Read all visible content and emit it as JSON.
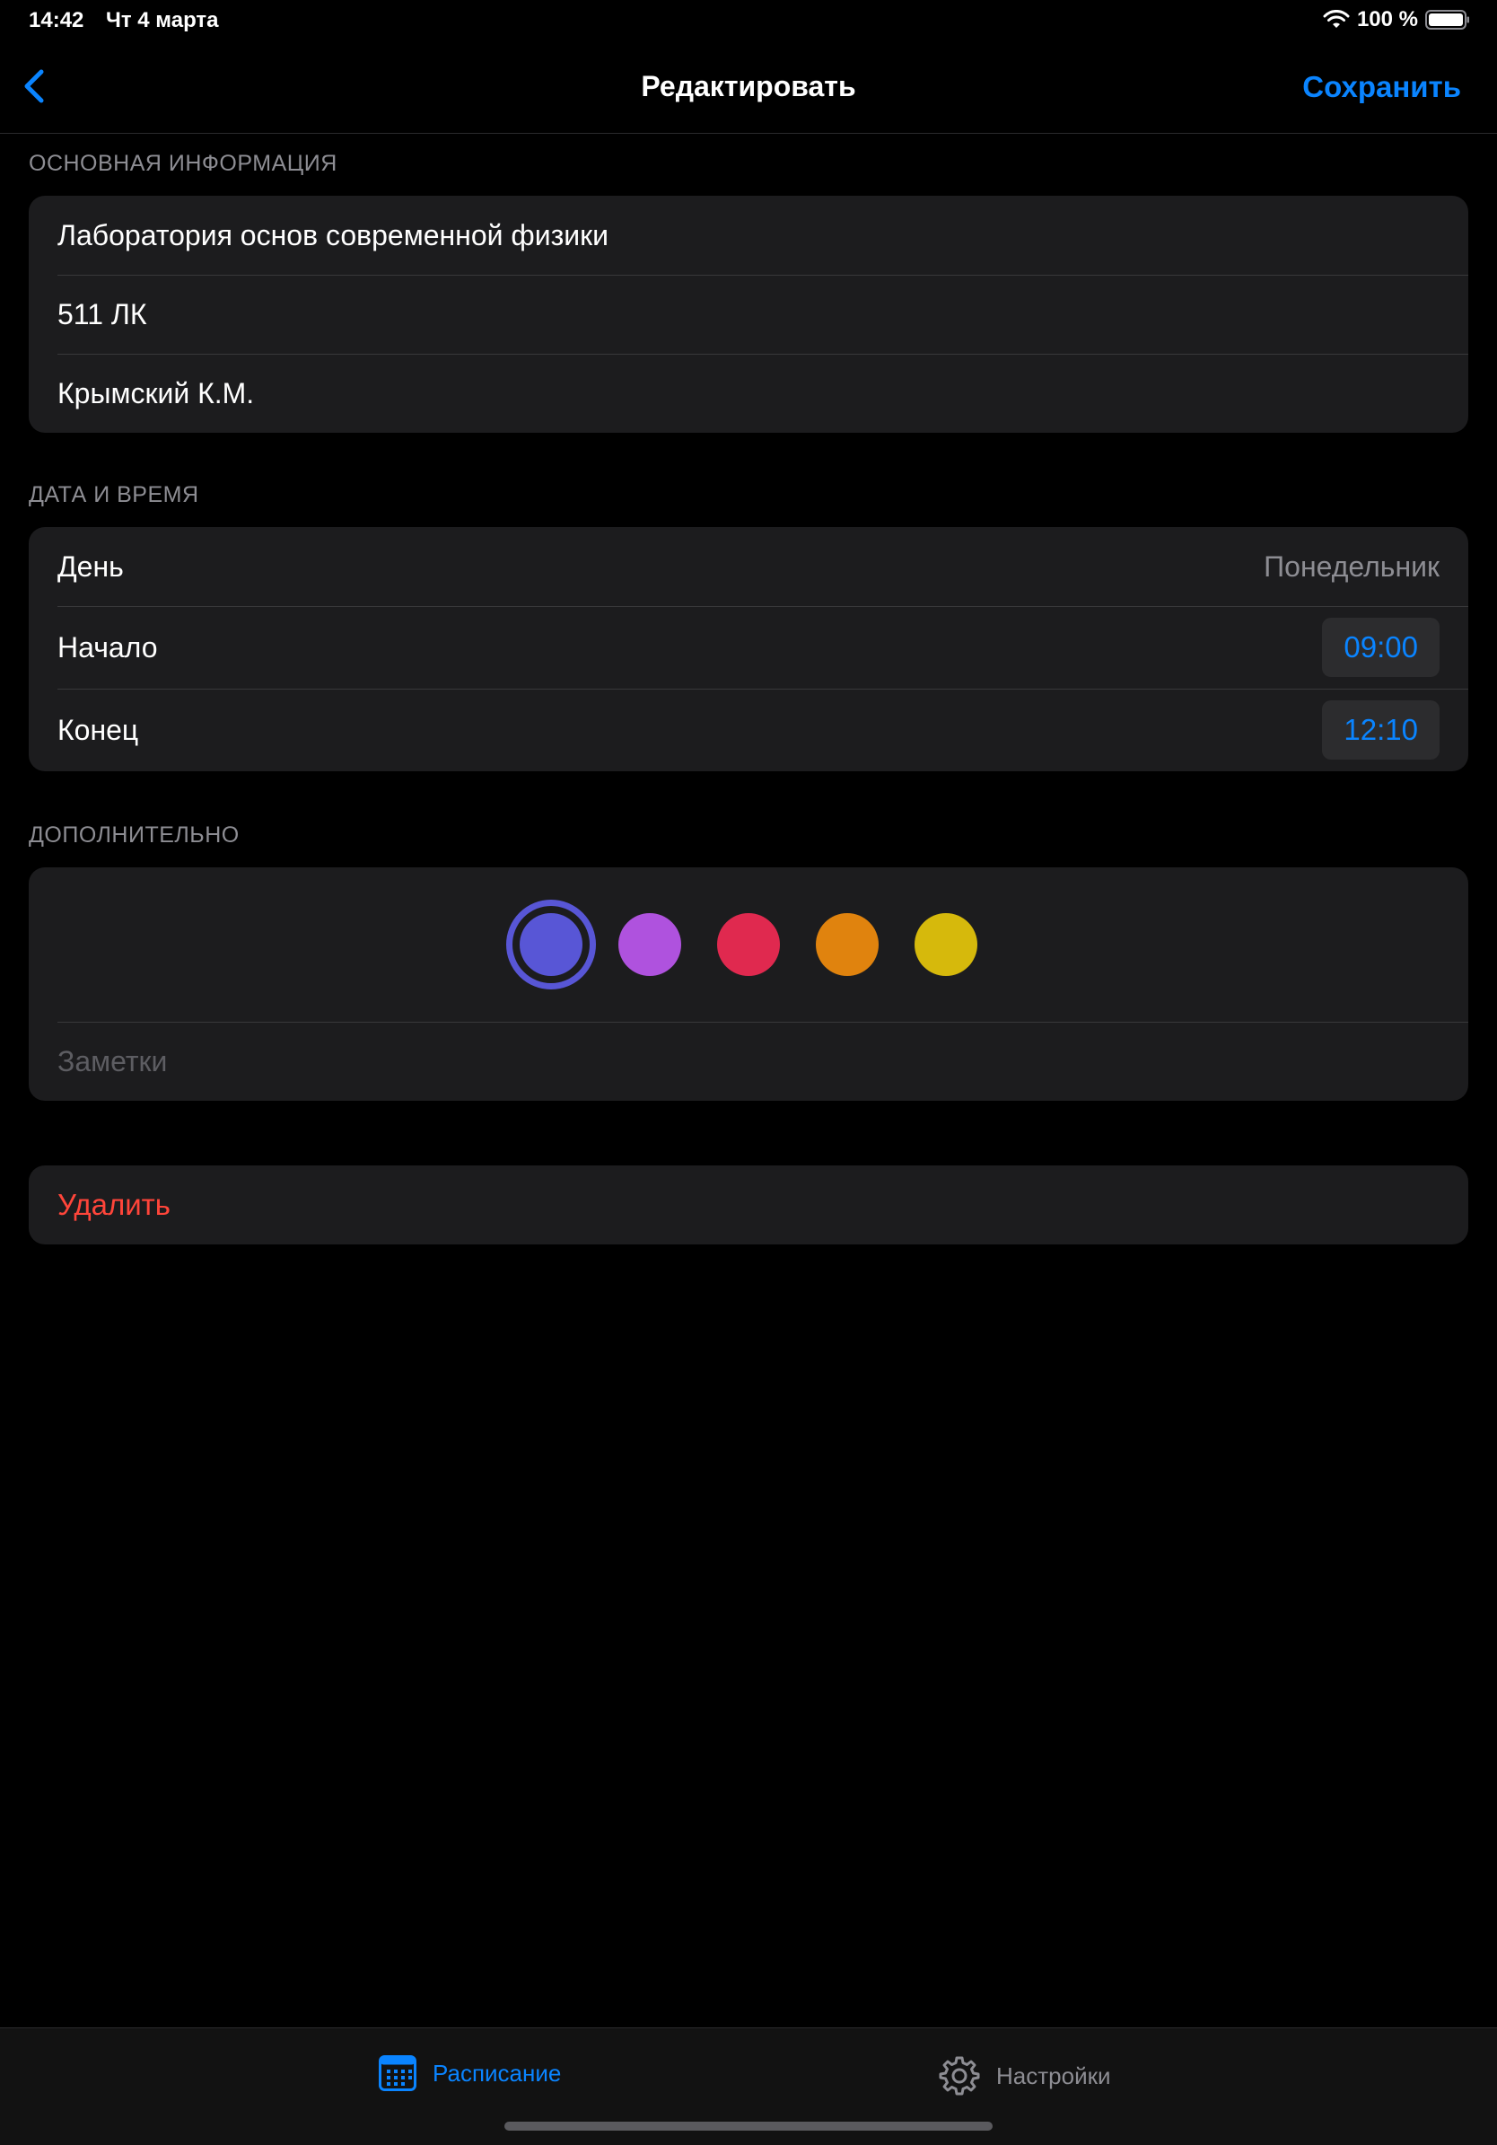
{
  "status_bar": {
    "time": "14:42",
    "date": "Чт 4 марта",
    "battery_text": "100 %",
    "wifi_icon": "wifi-icon",
    "battery_icon": "battery-full-icon"
  },
  "nav": {
    "title": "Редактировать",
    "save_label": "Сохранить",
    "back_icon": "chevron-left-icon"
  },
  "basic_info": {
    "header": "ОСНОВНАЯ ИНФОРМАЦИЯ",
    "subject": "Лаборатория основ современной физики",
    "room": "511 ЛК",
    "teacher": "Крымский К.М."
  },
  "date_time": {
    "header": "ДАТА И ВРЕМЯ",
    "day_label": "День",
    "day_value": "Понедельник",
    "start_label": "Начало",
    "start_value": "09:00",
    "end_label": "Конец",
    "end_value": "12:10"
  },
  "extra": {
    "header": "ДОПОЛНИТЕЛЬНО",
    "colors": [
      "#5856d6",
      "#af52de",
      "#e0294f",
      "#e0830e",
      "#d6b90c"
    ],
    "selected_color_index": 0,
    "notes_placeholder": "Заметки"
  },
  "delete_label": "Удалить",
  "tab_bar": {
    "schedule_label": "Расписание",
    "settings_label": "Настройки",
    "active_tab": "schedule",
    "accent_color": "#0a84ff",
    "destructive_color": "#ff453a"
  }
}
